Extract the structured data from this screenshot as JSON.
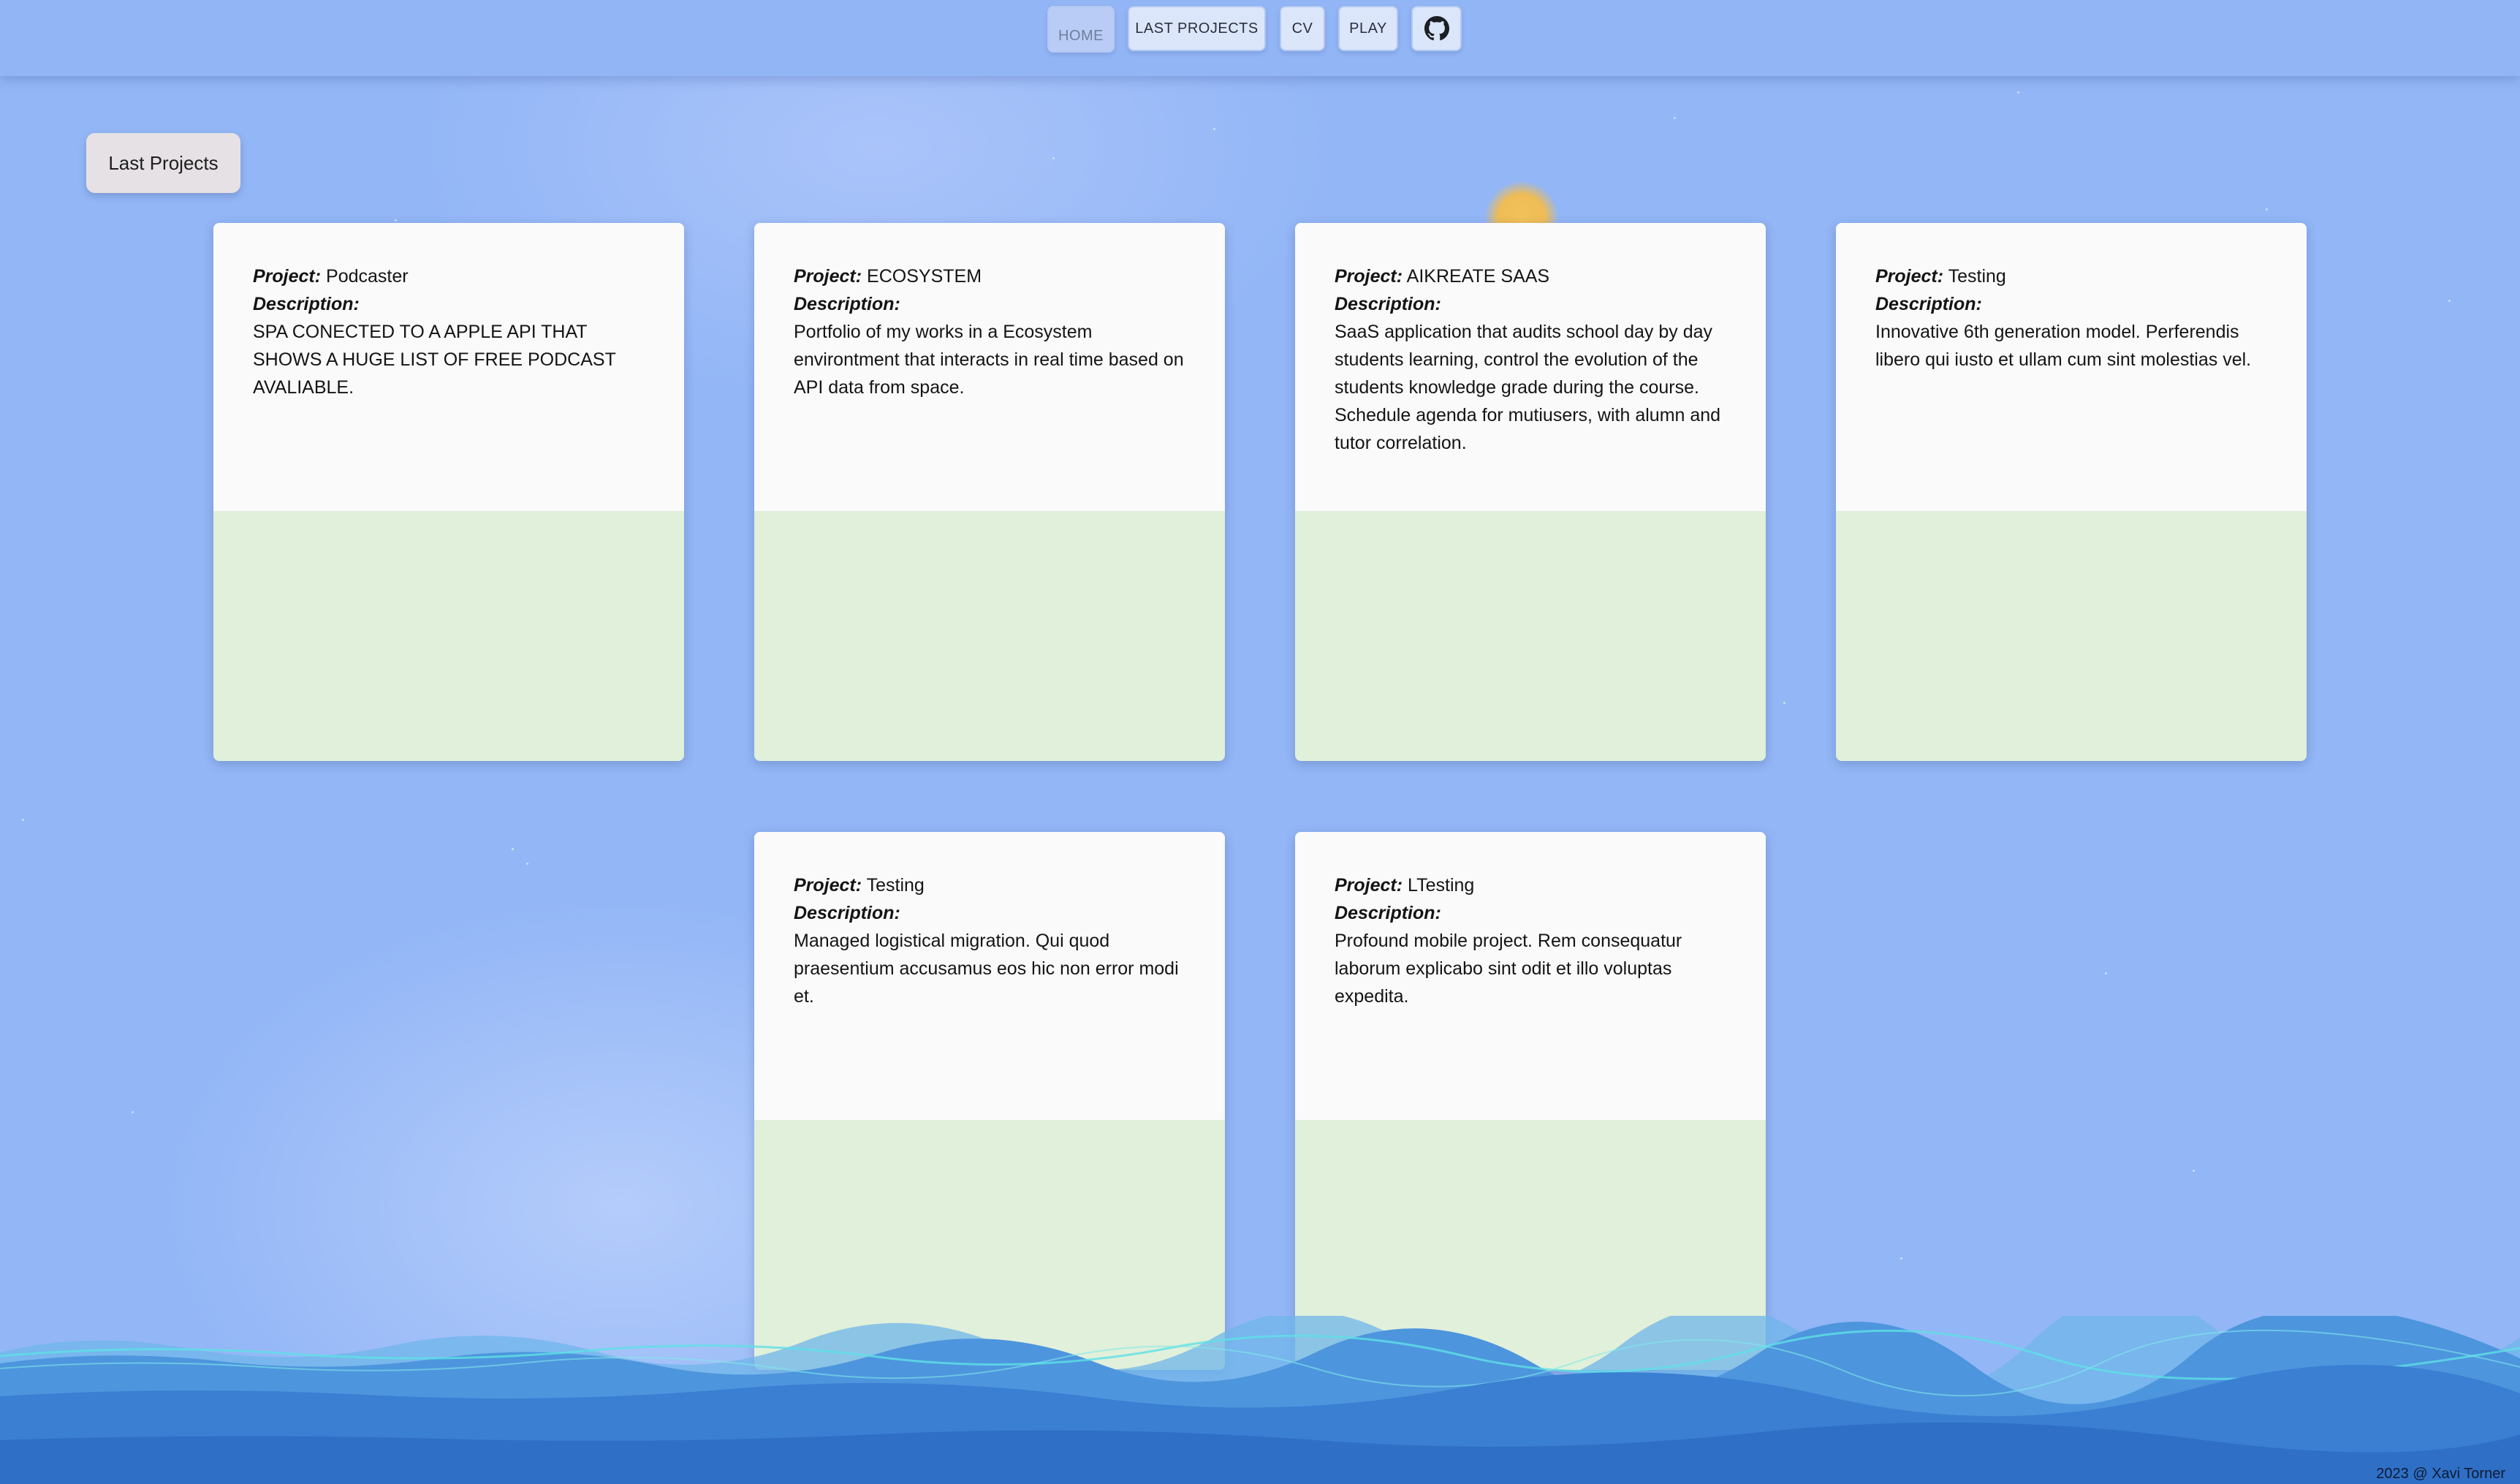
{
  "nav": {
    "home_label": "HOME",
    "projects_label": "LAST PROJECTS",
    "cv_label": "CV",
    "play_label": "PLAY",
    "github_icon": "github-icon"
  },
  "section": {
    "title": "Last Projects"
  },
  "labels": {
    "project": "Project:",
    "description": "Description:"
  },
  "projects": [
    {
      "name": "Podcaster",
      "description": "SPA CONECTED TO A APPLE API THAT SHOWS A HUGE LIST OF FREE PODCAST AVALIABLE."
    },
    {
      "name": "ECOSYSTEM",
      "description": "Portfolio of my works in a Ecosystem environtment that interacts in real time based on API data from space."
    },
    {
      "name": "AIKREATE SAAS",
      "description": "SaaS application that audits school day by day students learning, control the evolution of the students knowledge grade during the course. Schedule agenda for mutiusers, with alumn and tutor correlation."
    },
    {
      "name": "Testing",
      "description": "Innovative 6th generation model. Perferendis libero qui iusto et ullam cum sint molestias vel."
    },
    {
      "name": "Testing",
      "description": "Managed logistical migration. Qui quod praesentium accusamus eos hic non error modi et."
    },
    {
      "name": "LTesting",
      "description": "Profound mobile project. Rem consequatur laborum explicabo sint odit et illo voluptas expedita."
    }
  ],
  "footer": {
    "text": "2023 @ Xavi Torner"
  },
  "colors": {
    "sky": "#93b6f6",
    "card_bottom": "#e1f0da",
    "sun": "#efbc55",
    "sea": "#3d7fd6"
  }
}
